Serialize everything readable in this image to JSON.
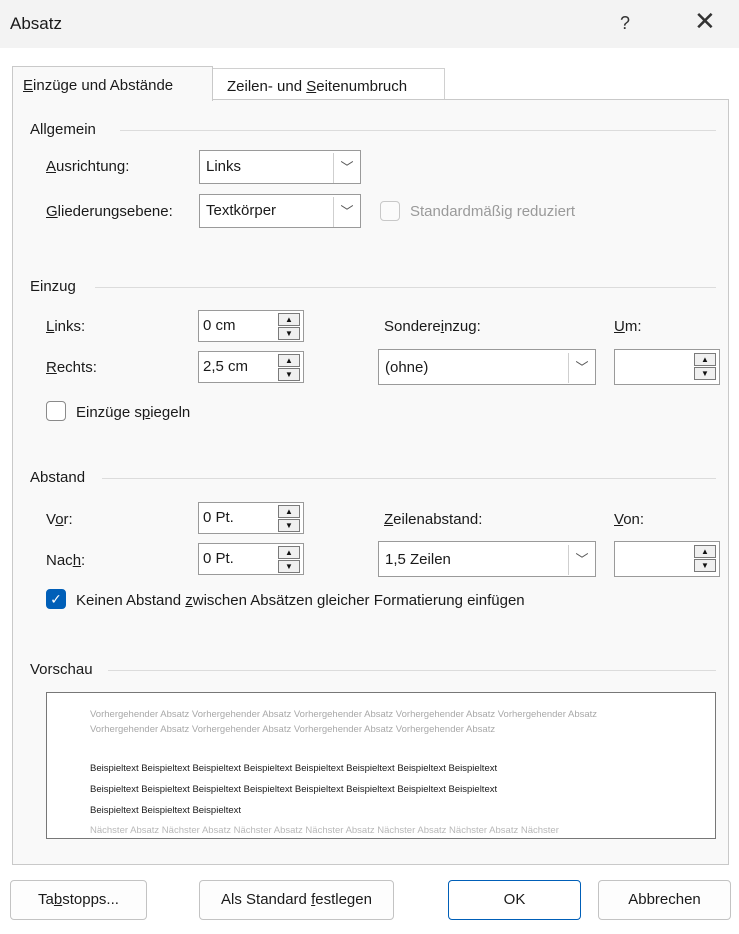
{
  "dialog": {
    "title": "Absatz",
    "help_glyph": "?",
    "close_glyph": "✕"
  },
  "tabs": [
    {
      "label": "Einzüge und Abstände",
      "accel": "E",
      "rest": "inzüge und Abstände",
      "active": true
    },
    {
      "label": "Zeilen- und Seitenumbruch",
      "pre": "Zeilen- und ",
      "accel": "S",
      "rest": "eitenumbruch",
      "active": false
    }
  ],
  "allgemein": {
    "section": "Allgemein",
    "alignment": {
      "accel": "A",
      "rest": "usrichtung:",
      "value": "Links"
    },
    "outline": {
      "accel": "G",
      "rest": "liederungsebene:",
      "value": "Textkörper"
    },
    "collapsed": {
      "label": "Standardmäßig reduziert",
      "checked": false,
      "disabled": true
    }
  },
  "einzug": {
    "section": "Einzug",
    "left": {
      "accel": "L",
      "rest": "inks:",
      "value": "0 cm"
    },
    "right": {
      "accel": "R",
      "rest": "echts:",
      "value": "2,5 cm"
    },
    "special": {
      "pre": "Sondere",
      "accel": "i",
      "rest": "nzug:",
      "value": "(ohne)"
    },
    "by": {
      "accel": "U",
      "rest": "m:",
      "value": ""
    },
    "mirror": {
      "pre": "Einzüge s",
      "accel": "p",
      "rest": "iegeln",
      "checked": false
    }
  },
  "abstand": {
    "section": "Abstand",
    "before": {
      "pre": "V",
      "accel": "o",
      "rest": "r:",
      "value": "0 Pt."
    },
    "after": {
      "pre": "Nac",
      "accel": "h",
      "rest": ":",
      "value": "0 Pt."
    },
    "line_spacing": {
      "accel": "Z",
      "rest": "eilenabstand:",
      "value": "1,5 Zeilen"
    },
    "at": {
      "accel": "V",
      "rest": "on:",
      "value": ""
    },
    "no_space": {
      "pre": "Keinen Abstand ",
      "accel": "z",
      "rest": "wischen Absätzen gleicher Formatierung einfügen",
      "checked": true
    }
  },
  "vorschau": {
    "section": "Vorschau",
    "previous": "Vorhergehender Absatz Vorhergehender Absatz Vorhergehender Absatz Vorhergehender Absatz Vorhergehender Absatz Vorhergehender Absatz Vorhergehender Absatz Vorhergehender Absatz Vorhergehender Absatz",
    "sample_lines": [
      "Beispieltext Beispieltext Beispieltext Beispieltext Beispieltext Beispieltext Beispieltext Beispieltext",
      "Beispieltext Beispieltext Beispieltext Beispieltext Beispieltext Beispieltext Beispieltext Beispieltext",
      "Beispieltext Beispieltext Beispieltext"
    ],
    "next": "Nächster Absatz Nächster Absatz Nächster Absatz Nächster Absatz Nächster Absatz Nächster Absatz Nächster"
  },
  "buttons": {
    "tabs": {
      "pre": "Ta",
      "accel": "b",
      "rest": "stopps..."
    },
    "default": {
      "pre": "Als Standard ",
      "accel": "f",
      "rest": "estlegen"
    },
    "ok": "OK",
    "cancel": "Abbrechen"
  },
  "colors": {
    "accent": "#005fb8",
    "panel": "#f9f9f9",
    "titlebar": "#f3f3f3"
  }
}
